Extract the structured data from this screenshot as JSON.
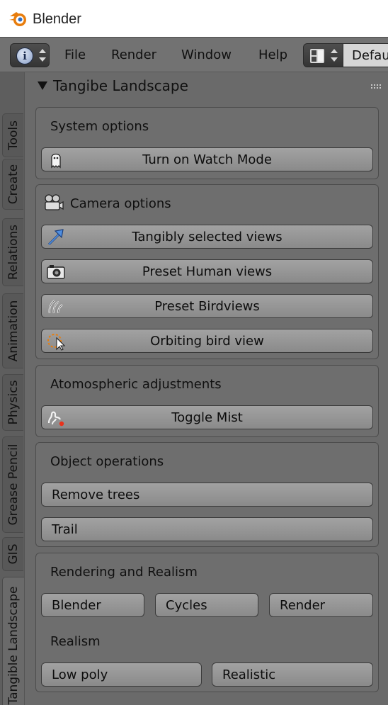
{
  "window": {
    "title": "Blender"
  },
  "menubar": {
    "items": [
      "File",
      "Render",
      "Window",
      "Help"
    ],
    "layout_value": "Default"
  },
  "tabs": [
    "Tools",
    "Create",
    "Relations",
    "Animation",
    "Physics",
    "Grease Pencil",
    "GIS",
    "Tangible Landscape"
  ],
  "panel": {
    "title": "Tangibe Landscape",
    "system": {
      "label": "System options",
      "watch_button": "Turn on Watch Mode"
    },
    "camera": {
      "label": "Camera options",
      "buttons": [
        "Tangibly selected views",
        "Preset Human views",
        "Preset Birdviews",
        "Orbiting bird view"
      ]
    },
    "atmosphere": {
      "label": "Atomospheric adjustments",
      "mist_button": "Toggle Mist"
    },
    "objects": {
      "label": "Object operations",
      "buttons": [
        "Remove trees",
        "Trail"
      ]
    },
    "rendering": {
      "label": "Rendering and Realism",
      "engine_buttons": [
        "Blender",
        "Cycles",
        "Render"
      ],
      "realism_label": "Realism",
      "realism_buttons": [
        "Low poly",
        "Realistic"
      ]
    }
  },
  "colors": {
    "panel_bg": "#6a6a6a",
    "button_bg": "#989898",
    "accent_orange": "#e87d0d",
    "accent_blue": "#2f6fc8"
  }
}
